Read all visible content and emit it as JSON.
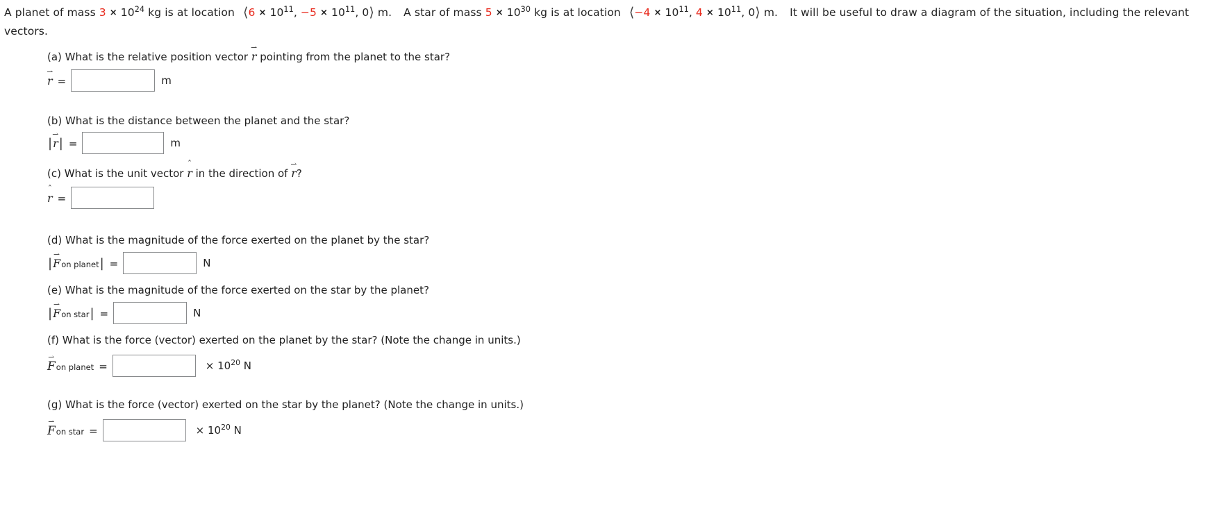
{
  "problem": {
    "segments": [
      {
        "t": "A planet of mass ",
        "c": "black"
      },
      {
        "t": "3",
        "c": "red"
      },
      {
        "t": " × 10",
        "c": "black",
        "sup": "24"
      },
      {
        "t": " kg is at location ",
        "c": "black"
      },
      {
        "t": "vector_open",
        "c": "black"
      },
      {
        "t": "6",
        "c": "red"
      },
      {
        "t": " × 10",
        "c": "black",
        "sup": "11"
      },
      {
        "t": ", ",
        "c": "black"
      },
      {
        "t": "−5",
        "c": "red"
      },
      {
        "t": " × 10",
        "c": "black",
        "sup": "11"
      },
      {
        "t": ", 0",
        "c": "black"
      },
      {
        "t": "vector_close",
        "c": "black"
      },
      {
        "t": " m.  A star of mass ",
        "c": "black"
      },
      {
        "t": "5",
        "c": "red"
      },
      {
        "t": " × 10",
        "c": "black",
        "sup": "30"
      },
      {
        "t": " kg is at location ",
        "c": "black"
      },
      {
        "t": "vector_open",
        "c": "black"
      },
      {
        "t": "−4",
        "c": "red"
      },
      {
        "t": " × 10",
        "c": "black",
        "sup": "11"
      },
      {
        "t": ", ",
        "c": "black"
      },
      {
        "t": "4",
        "c": "red"
      },
      {
        "t": " × 10",
        "c": "black",
        "sup": "11"
      },
      {
        "t": ", 0",
        "c": "black"
      },
      {
        "t": "vector_close",
        "c": "black"
      },
      {
        "t": " m.  It will be useful to draw a diagram of the situation, including the relevant vectors.",
        "c": "black"
      }
    ],
    "planet_mass_coefficient": "3",
    "planet_mass_exponent": "24",
    "planet_position": [
      "6 × 10^11",
      "−5 × 10^11",
      "0"
    ],
    "star_mass_coefficient": "5",
    "star_mass_exponent": "30",
    "star_position": [
      "−4 × 10^11",
      "4 × 10^11",
      "0"
    ],
    "accent_color": "#e8291c"
  },
  "parts": {
    "a": {
      "question_pre": "(a) What is the relative position vector ",
      "question_sym": "r",
      "question_post": " pointing from the planet to the star?",
      "label_sym": "r",
      "equals": "=",
      "value": "",
      "placeholder": "",
      "unit": "m"
    },
    "b": {
      "question": "(b) What is the distance between the planet and the star?",
      "label_sym": "r",
      "equals": "=",
      "value": "",
      "placeholder": "",
      "unit": "m"
    },
    "c": {
      "question_pre": "(c) What is the unit vector ",
      "question_sym_hat": "r",
      "question_mid": " in the direction of ",
      "question_sym_vec": "r",
      "question_post": "?",
      "label_sym": "r",
      "equals": "=",
      "value": "",
      "placeholder": "",
      "unit": ""
    },
    "d": {
      "question": "(d) What is the magnitude of the force exerted on the planet by the star?",
      "label_sym": "F",
      "label_sub": "on planet",
      "equals": "=",
      "value": "",
      "placeholder": "",
      "unit": "N"
    },
    "e": {
      "question": "(e) What is the magnitude of the force exerted on the star by the planet?",
      "label_sym": "F",
      "label_sub": "on star",
      "equals": "=",
      "value": "",
      "placeholder": "",
      "unit": "N"
    },
    "f": {
      "question": "(f) What is the force (vector) exerted on the planet by the star? (Note the change in units.)",
      "label_sym": "F",
      "label_sub": "on planet",
      "equals": "=",
      "value": "",
      "placeholder": "",
      "unit_prefix": "× 10",
      "unit_exponent": "20",
      "unit_suffix": " N"
    },
    "g": {
      "question": "(g) What is the force (vector) exerted on the star by the planet? (Note the change in units.)",
      "label_sym": "F",
      "label_sub": "on star",
      "equals": "=",
      "value": "",
      "placeholder": "",
      "unit_prefix": "× 10",
      "unit_exponent": "20",
      "unit_suffix": " N"
    }
  },
  "glyphs": {
    "vector_arrow": "→",
    "hat": "ˆ",
    "angle_open": "⟨",
    "angle_close": "⟩",
    "abs_bar": "|"
  }
}
